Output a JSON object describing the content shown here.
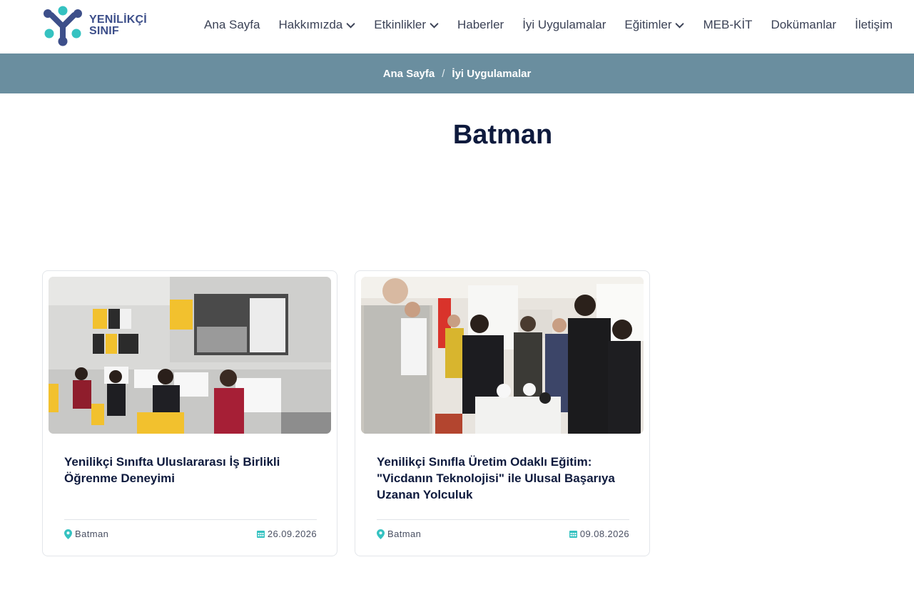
{
  "brand": {
    "name_line1": "YENİLİKÇİ",
    "name_line2": "SINIF"
  },
  "nav": {
    "items": [
      {
        "label": "Ana Sayfa",
        "dropdown": false
      },
      {
        "label": "Hakkımızda",
        "dropdown": true
      },
      {
        "label": "Etkinlikler",
        "dropdown": true
      },
      {
        "label": "Haberler",
        "dropdown": false
      },
      {
        "label": "İyi Uygulamalar",
        "dropdown": false
      },
      {
        "label": "Eğitimler",
        "dropdown": true
      },
      {
        "label": "MEB-KİT",
        "dropdown": false
      },
      {
        "label": "Dokümanlar",
        "dropdown": false
      },
      {
        "label": "İletişim",
        "dropdown": false
      }
    ]
  },
  "breadcrumb": {
    "home": "Ana Sayfa",
    "separator": "/",
    "current": "İyi Uygulamalar"
  },
  "page": {
    "title": "Batman"
  },
  "cards": [
    {
      "title": "Yenilikçi Sınıfta Uluslararası İş Birlikli Öğrenme Deneyimi",
      "location": "Batman",
      "date": "26.09.2026"
    },
    {
      "title": "Yenilikçi Sınıfla Üretim Odaklı Eğitim: \"Vicdanın Teknolojisi\" ile Ulusal Başarıya Uzanan Yolculuk",
      "location": "Batman",
      "date": "09.08.2026"
    }
  ],
  "colors": {
    "accent_teal": "#35c2c1",
    "brand_navy": "#3d4f8a",
    "breadcrumb_bg": "#6a8e9f",
    "title_navy": "#0e1a3d"
  }
}
